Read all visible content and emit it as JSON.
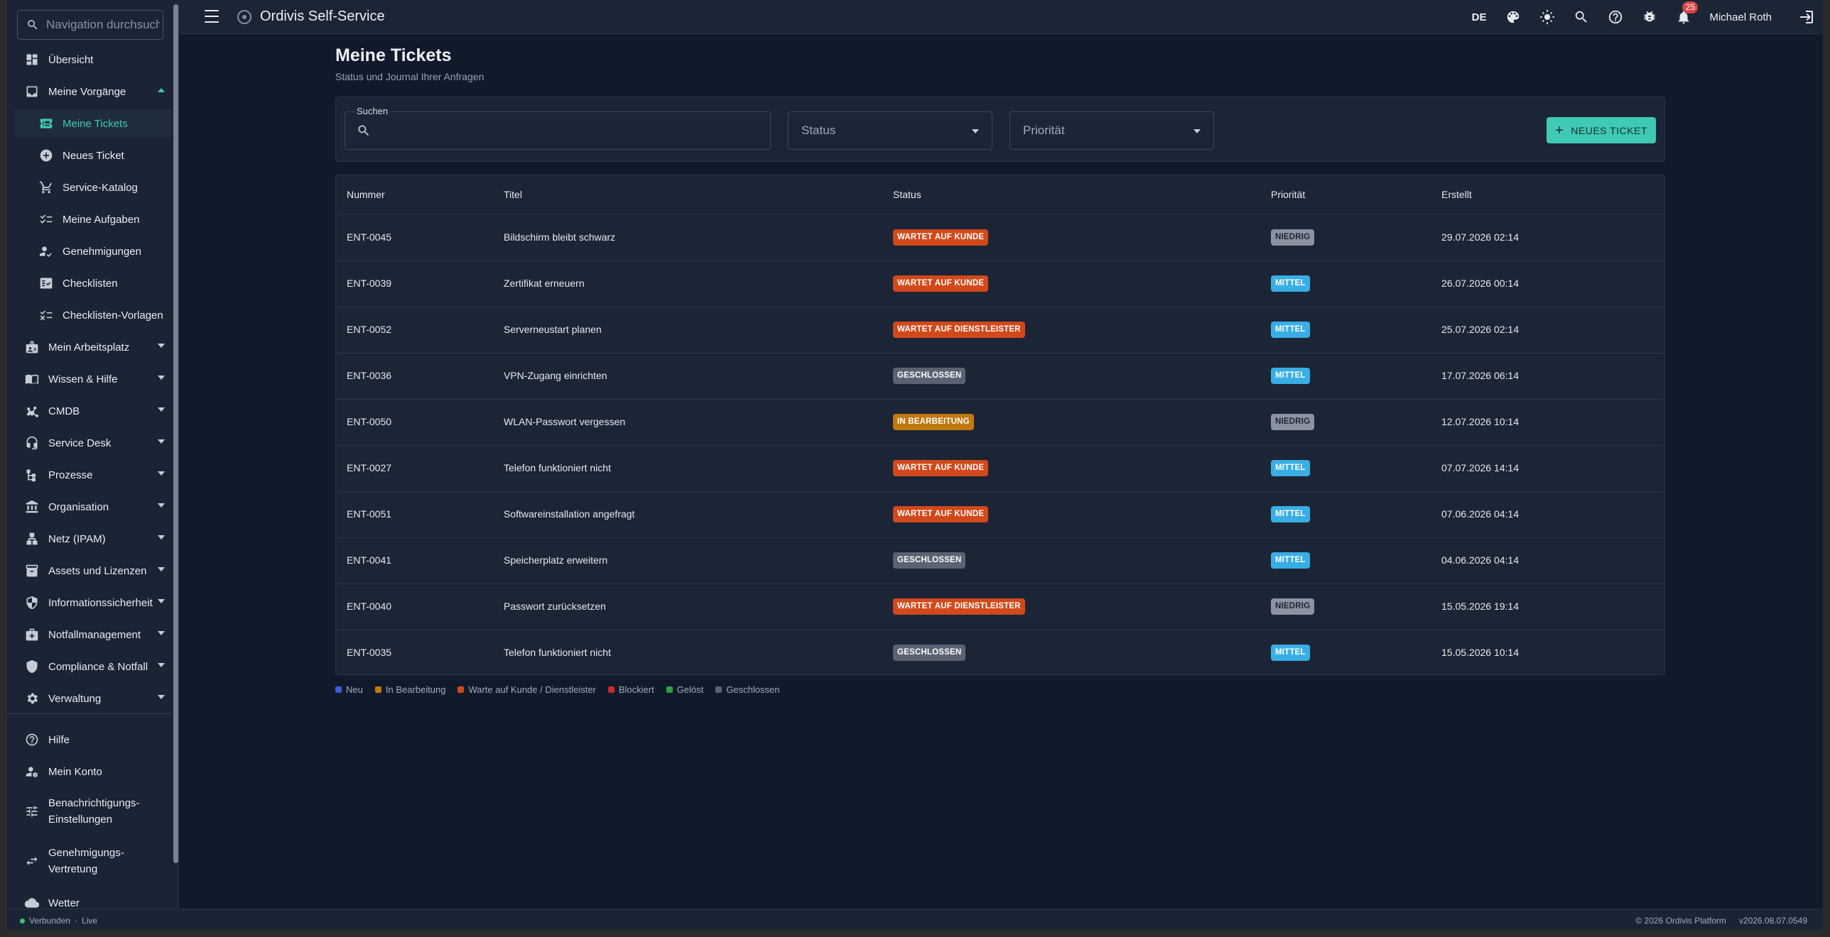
{
  "app": {
    "title": "Ordivis Self-Service"
  },
  "sidebar": {
    "search_placeholder": "Navigation durchsuchen",
    "items": [
      {
        "label": "Übersicht",
        "icon": "dashboard-icon"
      },
      {
        "label": "Meine Vorgänge",
        "icon": "inbox-icon",
        "expanded": true
      },
      {
        "label": "Meine Tickets",
        "icon": "ticket-icon",
        "active": true
      },
      {
        "label": "Neues Ticket",
        "icon": "add-circle-icon"
      },
      {
        "label": "Service-Katalog",
        "icon": "cart-icon"
      },
      {
        "label": "Meine Aufgaben",
        "icon": "checklist-icon"
      },
      {
        "label": "Genehmigungen",
        "icon": "approval-icon"
      },
      {
        "label": "Checklisten",
        "icon": "fact-check-icon"
      },
      {
        "label": "Checklisten-Vorlagen",
        "icon": "checklist-template-icon"
      },
      {
        "label": "Mein Arbeitsplatz",
        "icon": "badge-icon"
      },
      {
        "label": "Wissen & Hilfe",
        "icon": "book-icon"
      },
      {
        "label": "CMDB",
        "icon": "hub-icon"
      },
      {
        "label": "Service Desk",
        "icon": "headset-icon"
      },
      {
        "label": "Prozesse",
        "icon": "flow-icon"
      },
      {
        "label": "Organisation",
        "icon": "institution-icon"
      },
      {
        "label": "Netz (IPAM)",
        "icon": "network-icon"
      },
      {
        "label": "Assets und Lizenzen",
        "icon": "archive-icon"
      },
      {
        "label": "Informationssicherheit",
        "icon": "security-icon"
      },
      {
        "label": "Notfallmanagement",
        "icon": "medical-bag-icon"
      },
      {
        "label": "Compliance & Notfall",
        "icon": "shield-icon"
      },
      {
        "label": "Verwaltung",
        "icon": "settings-icon"
      }
    ],
    "bottom_items": [
      {
        "label": "Hilfe",
        "icon": "help-icon"
      },
      {
        "label": "Mein Konto",
        "icon": "account-settings-icon"
      },
      {
        "label_line1": "Benachrichtigungs-",
        "label_line2": "Einstellungen",
        "icon": "tune-icon"
      },
      {
        "label_line1": "Genehmigungs-",
        "label_line2": "Vertretung",
        "icon": "swap-icon"
      },
      {
        "label": "Wetter",
        "icon": "cloud-icon"
      }
    ]
  },
  "topbar": {
    "language": "DE",
    "notifications_count": "25",
    "user_name": "Michael Roth"
  },
  "page": {
    "title": "Meine Tickets",
    "subtitle": "Status und Journal Ihrer Anfragen"
  },
  "filters": {
    "search_label": "Suchen",
    "search_value": "",
    "status_placeholder": "Status",
    "priority_placeholder": "Priorität",
    "new_ticket_label": "NEUES TICKET"
  },
  "table": {
    "headers": {
      "number": "Nummer",
      "title": "Titel",
      "status": "Status",
      "priority": "Priorität",
      "created": "Erstellt"
    },
    "rows": [
      {
        "number": "ENT-0045",
        "title": "Bildschirm bleibt schwarz",
        "status": "WARTET AUF KUNDE",
        "status_color": "#d1491b",
        "priority": "NIEDRIG",
        "priority_color": "#8b93a3",
        "created": "29.07.2026 02:14"
      },
      {
        "number": "ENT-0039",
        "title": "Zertifikat erneuern",
        "status": "WARTET AUF KUNDE",
        "status_color": "#d1491b",
        "priority": "MITTEL",
        "priority_color": "#38aee5",
        "created": "26.07.2026 00:14"
      },
      {
        "number": "ENT-0052",
        "title": "Serverneustart planen",
        "status": "WARTET AUF DIENSTLEISTER",
        "status_color": "#d1491b",
        "priority": "MITTEL",
        "priority_color": "#38aee5",
        "created": "25.07.2026 02:14"
      },
      {
        "number": "ENT-0036",
        "title": "VPN-Zugang einrichten",
        "status": "GESCHLOSSEN",
        "status_color": "#5b6372",
        "priority": "MITTEL",
        "priority_color": "#38aee5",
        "created": "17.07.2026 06:14"
      },
      {
        "number": "ENT-0050",
        "title": "WLAN-Passwort vergessen",
        "status": "IN BEARBEITUNG",
        "status_color": "#c0780f",
        "priority": "NIEDRIG",
        "priority_color": "#8b93a3",
        "created": "12.07.2026 10:14"
      },
      {
        "number": "ENT-0027",
        "title": "Telefon funktioniert nicht",
        "status": "WARTET AUF KUNDE",
        "status_color": "#d1491b",
        "priority": "MITTEL",
        "priority_color": "#38aee5",
        "created": "07.07.2026 14:14"
      },
      {
        "number": "ENT-0051",
        "title": "Softwareinstallation angefragt",
        "status": "WARTET AUF KUNDE",
        "status_color": "#d1491b",
        "priority": "MITTEL",
        "priority_color": "#38aee5",
        "created": "07.06.2026 04:14"
      },
      {
        "number": "ENT-0041",
        "title": "Speicherplatz erweitern",
        "status": "GESCHLOSSEN",
        "status_color": "#5b6372",
        "priority": "MITTEL",
        "priority_color": "#38aee5",
        "created": "04.06.2026 04:14"
      },
      {
        "number": "ENT-0040",
        "title": "Passwort zurücksetzen",
        "status": "WARTET AUF DIENSTLEISTER",
        "status_color": "#d1491b",
        "priority": "NIEDRIG",
        "priority_color": "#8b93a3",
        "created": "15.05.2026 19:14"
      },
      {
        "number": "ENT-0035",
        "title": "Telefon funktioniert nicht",
        "status": "GESCHLOSSEN",
        "status_color": "#5b6372",
        "priority": "MITTEL",
        "priority_color": "#38aee5",
        "created": "15.05.2026 10:14"
      }
    ]
  },
  "legend": [
    {
      "label": "Neu",
      "color": "#3b5bdb"
    },
    {
      "label": "In Bearbeitung",
      "color": "#c0780f"
    },
    {
      "label": "Warte auf Kunde / Dienstleister",
      "color": "#d1491b"
    },
    {
      "label": "Blockiert",
      "color": "#c92a2a"
    },
    {
      "label": "Gelöst",
      "color": "#2f9e44"
    },
    {
      "label": "Geschlossen",
      "color": "#5b6372"
    }
  ],
  "footer": {
    "connection": "Verbunden",
    "mode": "Live",
    "copyright": "© 2026 Ordivis Platform",
    "version": "v2026.08.07.0549"
  },
  "colors": {
    "accent": "#40c9b4",
    "background": "#111a2b",
    "surface": "#1c2536"
  }
}
